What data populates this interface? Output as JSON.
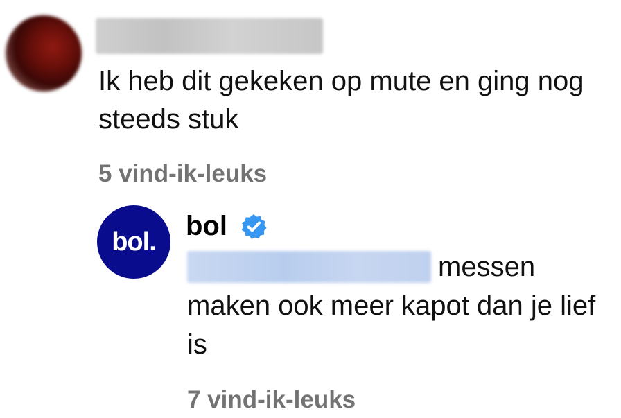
{
  "comment": {
    "text": "Ik heb dit gekeken op mute en ging nog steeds stuk",
    "likes": "5 vind-ik-leuks"
  },
  "reply": {
    "author": "bol",
    "avatar_text": "bol.",
    "verified": true,
    "text": "messen maken ook meer kapot dan je lief is",
    "likes": "7 vind-ik-leuks"
  },
  "colors": {
    "brand": "#0a0c8e",
    "verified": "#3897f0",
    "muted_text": "#737373"
  },
  "icons": {
    "verified": "verified-badge-icon"
  }
}
